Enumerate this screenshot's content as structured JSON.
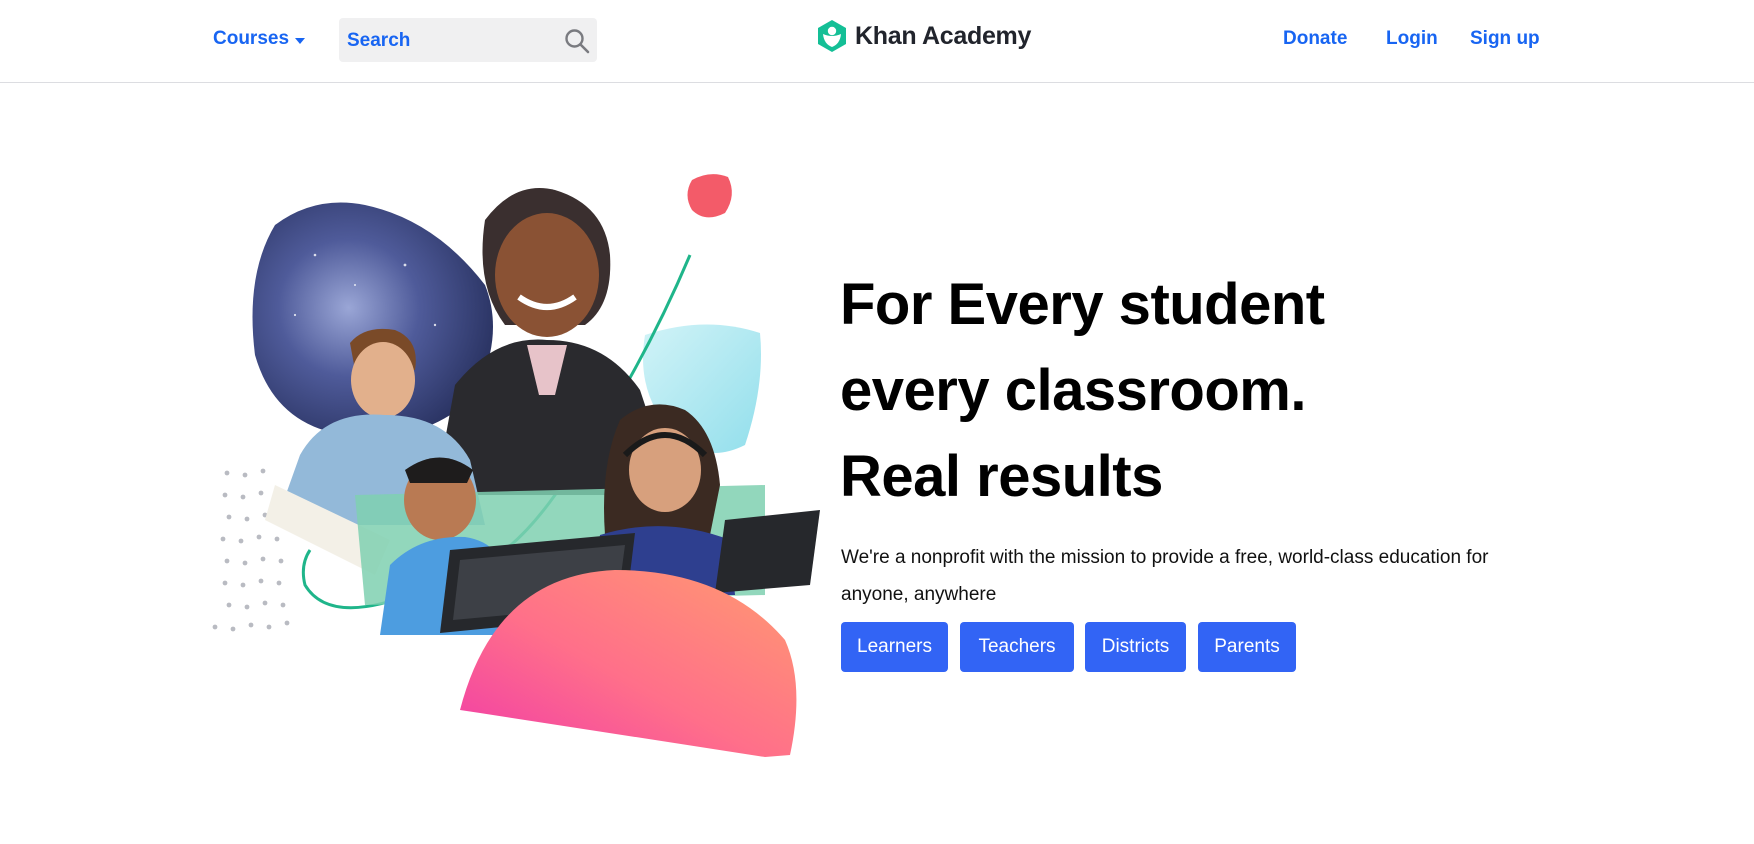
{
  "header": {
    "courses_label": "Courses",
    "search": {
      "placeholder": "Search"
    },
    "logo_text": "Khan Academy",
    "nav": {
      "donate": "Donate",
      "login": "Login",
      "signup": "Sign up"
    }
  },
  "hero": {
    "headline": [
      "For Every student",
      "every classroom.",
      "Real results"
    ],
    "mission": "We're a nonprofit with the mission to provide a free, world-class education for anyone, anywhere",
    "buttons": [
      "Learners",
      "Teachers",
      "Districts",
      "Parents"
    ]
  },
  "colors": {
    "link": "#1865f2",
    "button": "#3264f5",
    "brand_green": "#14bf96",
    "text": "#0b0b0b"
  },
  "icons": [
    "chevron-down-icon",
    "search-icon",
    "khan-academy-logo-icon"
  ]
}
